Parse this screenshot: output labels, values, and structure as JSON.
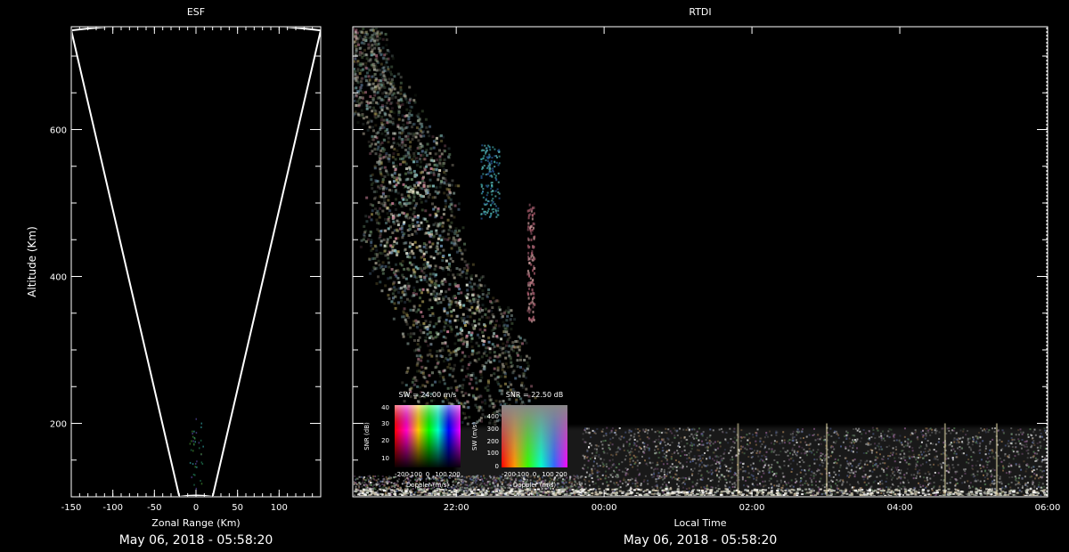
{
  "colors": {
    "background": "#000000",
    "axis": "#ffffff",
    "fan_outline": "#ffffff"
  },
  "chart_data": [
    {
      "type": "heatmap",
      "title": "ESF",
      "xlabel": "Zonal Range (Km)",
      "ylabel": "Altitude (Km)",
      "xlim": [
        -150,
        150
      ],
      "ylim": [
        100,
        740
      ],
      "x_ticks": [
        -150,
        -100,
        -50,
        0,
        50,
        100
      ],
      "x_tick_labels": [
        "-150",
        "-100",
        "-50",
        "0",
        "50",
        "100"
      ],
      "y_ticks": [
        200,
        400,
        600
      ],
      "y_tick_labels": [
        "200",
        "400",
        "600"
      ],
      "fan_outline": {
        "edges": [
          [
            -150,
            735
          ],
          [
            -20,
            100
          ],
          [
            20,
            100
          ],
          [
            150,
            735
          ]
        ],
        "apex_altitude": 745
      },
      "timestamp": "May 06, 2018 - 05:58:20"
    },
    {
      "type": "heatmap",
      "title": "RTDI",
      "xlabel": "Local Time",
      "ylabel": "",
      "x_ticks_hours": [
        22,
        24,
        26,
        28,
        30
      ],
      "x_tick_labels": [
        "22:00",
        "00:00",
        "02:00",
        "04:00",
        "06:00"
      ],
      "xlim_hours": [
        20.6,
        30.0
      ],
      "ylim": [
        100,
        740
      ],
      "echo_regions": [
        {
          "name": "plume",
          "t_start": 20.6,
          "t_end": 23.3,
          "alt_low": 200,
          "alt_high": 740
        },
        {
          "name": "bottomside layer",
          "t_start": 22.0,
          "t_end": 30.0,
          "alt_low": 100,
          "alt_high": 195
        }
      ],
      "timestamp": "May 06, 2018 - 05:58:20"
    }
  ],
  "legends": {
    "legend1": {
      "title": "SW = 24.00 m/s",
      "ylabel": "SNR (dB)",
      "xlabel": "Doppler (m/s)",
      "y_tick_labels": [
        "40",
        "30",
        "20",
        "10"
      ],
      "x_tick_labels": [
        "-200",
        "-100",
        "0",
        "100",
        "200"
      ]
    },
    "legend2": {
      "title": "SNR = 22.50 dB",
      "ylabel": "SW (m/s)",
      "xlabel": "Doppler (m/s)",
      "y_tick_labels": [
        "400",
        "300",
        "200",
        "100",
        "0"
      ],
      "x_tick_labels": [
        "-200",
        "-100",
        "0",
        "100",
        "200"
      ]
    }
  }
}
